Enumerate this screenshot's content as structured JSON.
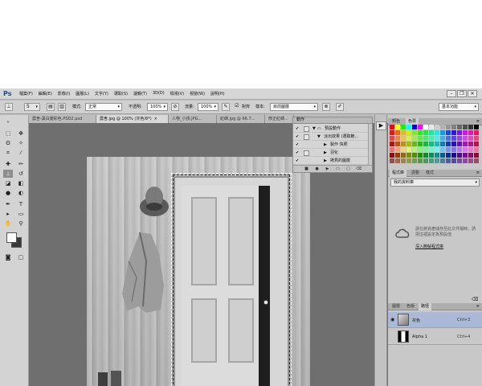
{
  "app": {
    "logo": "Ps"
  },
  "menu": [
    "檔案(F)",
    "編輯(E)",
    "影像(I)",
    "圖層(L)",
    "文字(Y)",
    "選取(S)",
    "濾鏡(T)",
    "3D(D)",
    "檢視(V)",
    "視窗(W)",
    "說明(H)"
  ],
  "window_controls": {
    "minimize": "–",
    "restore": "❐",
    "close": "✕"
  },
  "options_bar": {
    "mode_label": "模式:",
    "mode_value": "正常",
    "opacity_label": "不透明:",
    "opacity_value": "100%",
    "flow_label": "流量:",
    "flow_value": "100%",
    "align_label": "對齊",
    "sample_label": "樣本:",
    "sample_value": "目前圖層",
    "brush_size": "5",
    "workspace": "基本功能"
  },
  "tabs": [
    {
      "label": "農舍-黑白變彩色.PSD2.psd",
      "active": false
    },
    {
      "label": "農舍.jpg @ 100% (灰色/8*)",
      "active": true
    },
    {
      "label": "人物_小孩.JPG...",
      "active": false
    },
    {
      "label": "紅磚.jpg @ 66.7...",
      "active": false
    },
    {
      "label": "修正紅磚...",
      "active": false
    }
  ],
  "actions_panel": {
    "title": "動作",
    "rows": [
      {
        "label": "預設動作",
        "level": 0,
        "checked": true
      },
      {
        "label": "淡出效果 (選取範...",
        "level": 1,
        "checked": true
      },
      {
        "label": "製作 快照",
        "level": 2,
        "checked": true
      },
      {
        "label": "羽化",
        "level": 2,
        "checked": false
      },
      {
        "label": "拷貝的圖層",
        "level": 2,
        "checked": true
      }
    ]
  },
  "right_panels": {
    "color_tabs": [
      "顏色",
      "色票"
    ],
    "library_tabs": [
      "程式庫",
      "調整",
      "樣式"
    ],
    "library_select": "我的資料庫",
    "library_message": "請在將資產儲存至此文件檔時，請把這裡設定為預設值",
    "library_link": "深入瞭解程式庫",
    "channel_tabs": [
      "圖層",
      "色版",
      "路徑"
    ],
    "channels": [
      {
        "name": "灰色",
        "key": "Ctrl+3",
        "selected": true
      },
      {
        "name": "Alpha 1",
        "key": "Ctrl+4",
        "selected": false
      }
    ]
  },
  "colors": {
    "accent": "#1c4a8c",
    "selected_row": "#a9b9d6",
    "swatches": [
      "#ff0000",
      "#ffff00",
      "#00ff00",
      "#00ffff",
      "#0000ff",
      "#ff00ff",
      "#ffffff",
      "#e6e6e6",
      "#cccccc",
      "#b3b3b3",
      "#999999",
      "#808080",
      "#666666",
      "#4d4d4d",
      "#333333",
      "#000000"
    ]
  }
}
